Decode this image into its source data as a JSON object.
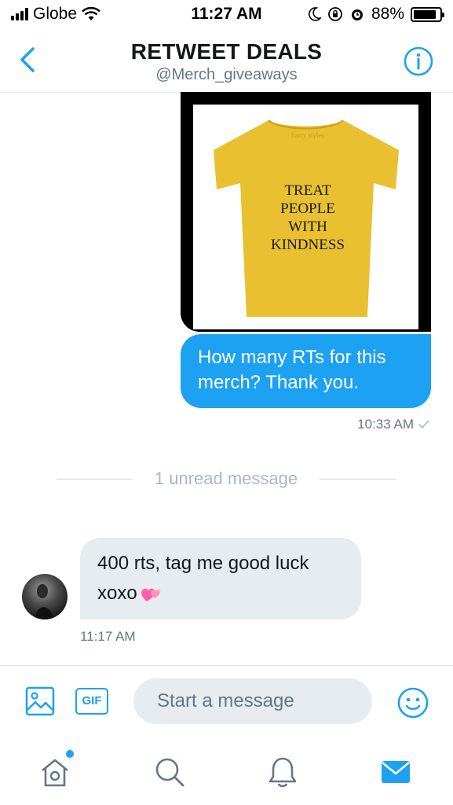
{
  "status_bar": {
    "carrier": "Globe",
    "time": "11:27 AM",
    "battery": "88%",
    "battery_level": 0.88
  },
  "header": {
    "title": "RETWEET DEALS",
    "handle": "@Merch_giveaways",
    "back_icon": "chevron-left-icon",
    "info_icon": "info-icon"
  },
  "shirt": {
    "brand": "harry styles",
    "lines": [
      "TREAT",
      "PEOPLE",
      "WITH",
      "KINDNESS"
    ],
    "color": "#e9c02f"
  },
  "messages": {
    "outgoing": {
      "text": "How many RTs for this merch? Thank you.",
      "time": "10:33 AM"
    },
    "unread_divider": "1 unread message",
    "incoming": {
      "text_line1": "400 rts, tag me good luck",
      "text_line2": "xoxo",
      "emoji": "heart-icon",
      "time": "11:17 AM"
    }
  },
  "composer": {
    "gif_label": "GIF",
    "placeholder": "Start a message"
  },
  "tabs": [
    "home",
    "search",
    "notifications",
    "messages"
  ],
  "colors": {
    "accent": "#1da1f2",
    "bubble_in": "#e6ecf0",
    "muted": "#657786"
  }
}
